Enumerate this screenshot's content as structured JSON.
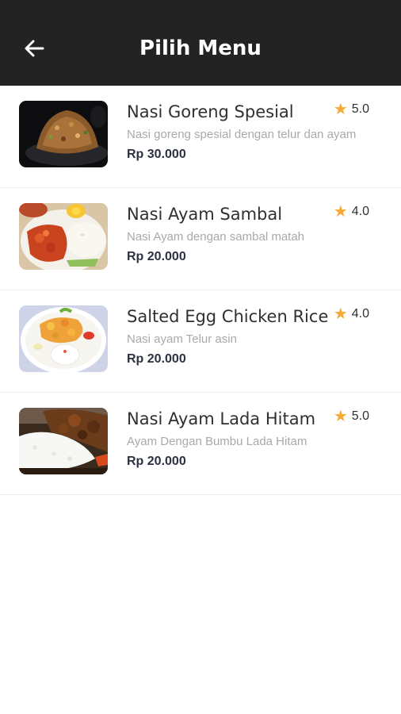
{
  "header": {
    "title": "Pilih Menu",
    "back_icon": "arrow-left-icon"
  },
  "colors": {
    "topbar": "#232323",
    "star": "#f6a936",
    "price": "#2c3142",
    "desc": "#a9a9ad"
  },
  "menu": [
    {
      "name": "Nasi Goreng Spesial",
      "description": "Nasi goreng spesial dengan telur dan ayam",
      "price": "Rp 30.000",
      "rating": "5.0",
      "image": "fried-rice-photo"
    },
    {
      "name": "Nasi Ayam Sambal",
      "description": "Nasi Ayam dengan sambal matah",
      "price": "Rp 20.000",
      "rating": "4.0",
      "image": "sambal-chicken-rice-photo"
    },
    {
      "name": "Salted Egg Chicken Rice",
      "description": "Nasi ayam Telur asin",
      "price": "Rp 20.000",
      "rating": "4.0",
      "image": "salted-egg-chicken-rice-photo"
    },
    {
      "name": "Nasi Ayam Lada Hitam",
      "description": "Ayam Dengan Bumbu Lada Hitam",
      "price": "Rp 20.000",
      "rating": "5.0",
      "image": "black-pepper-chicken-rice-photo"
    }
  ]
}
